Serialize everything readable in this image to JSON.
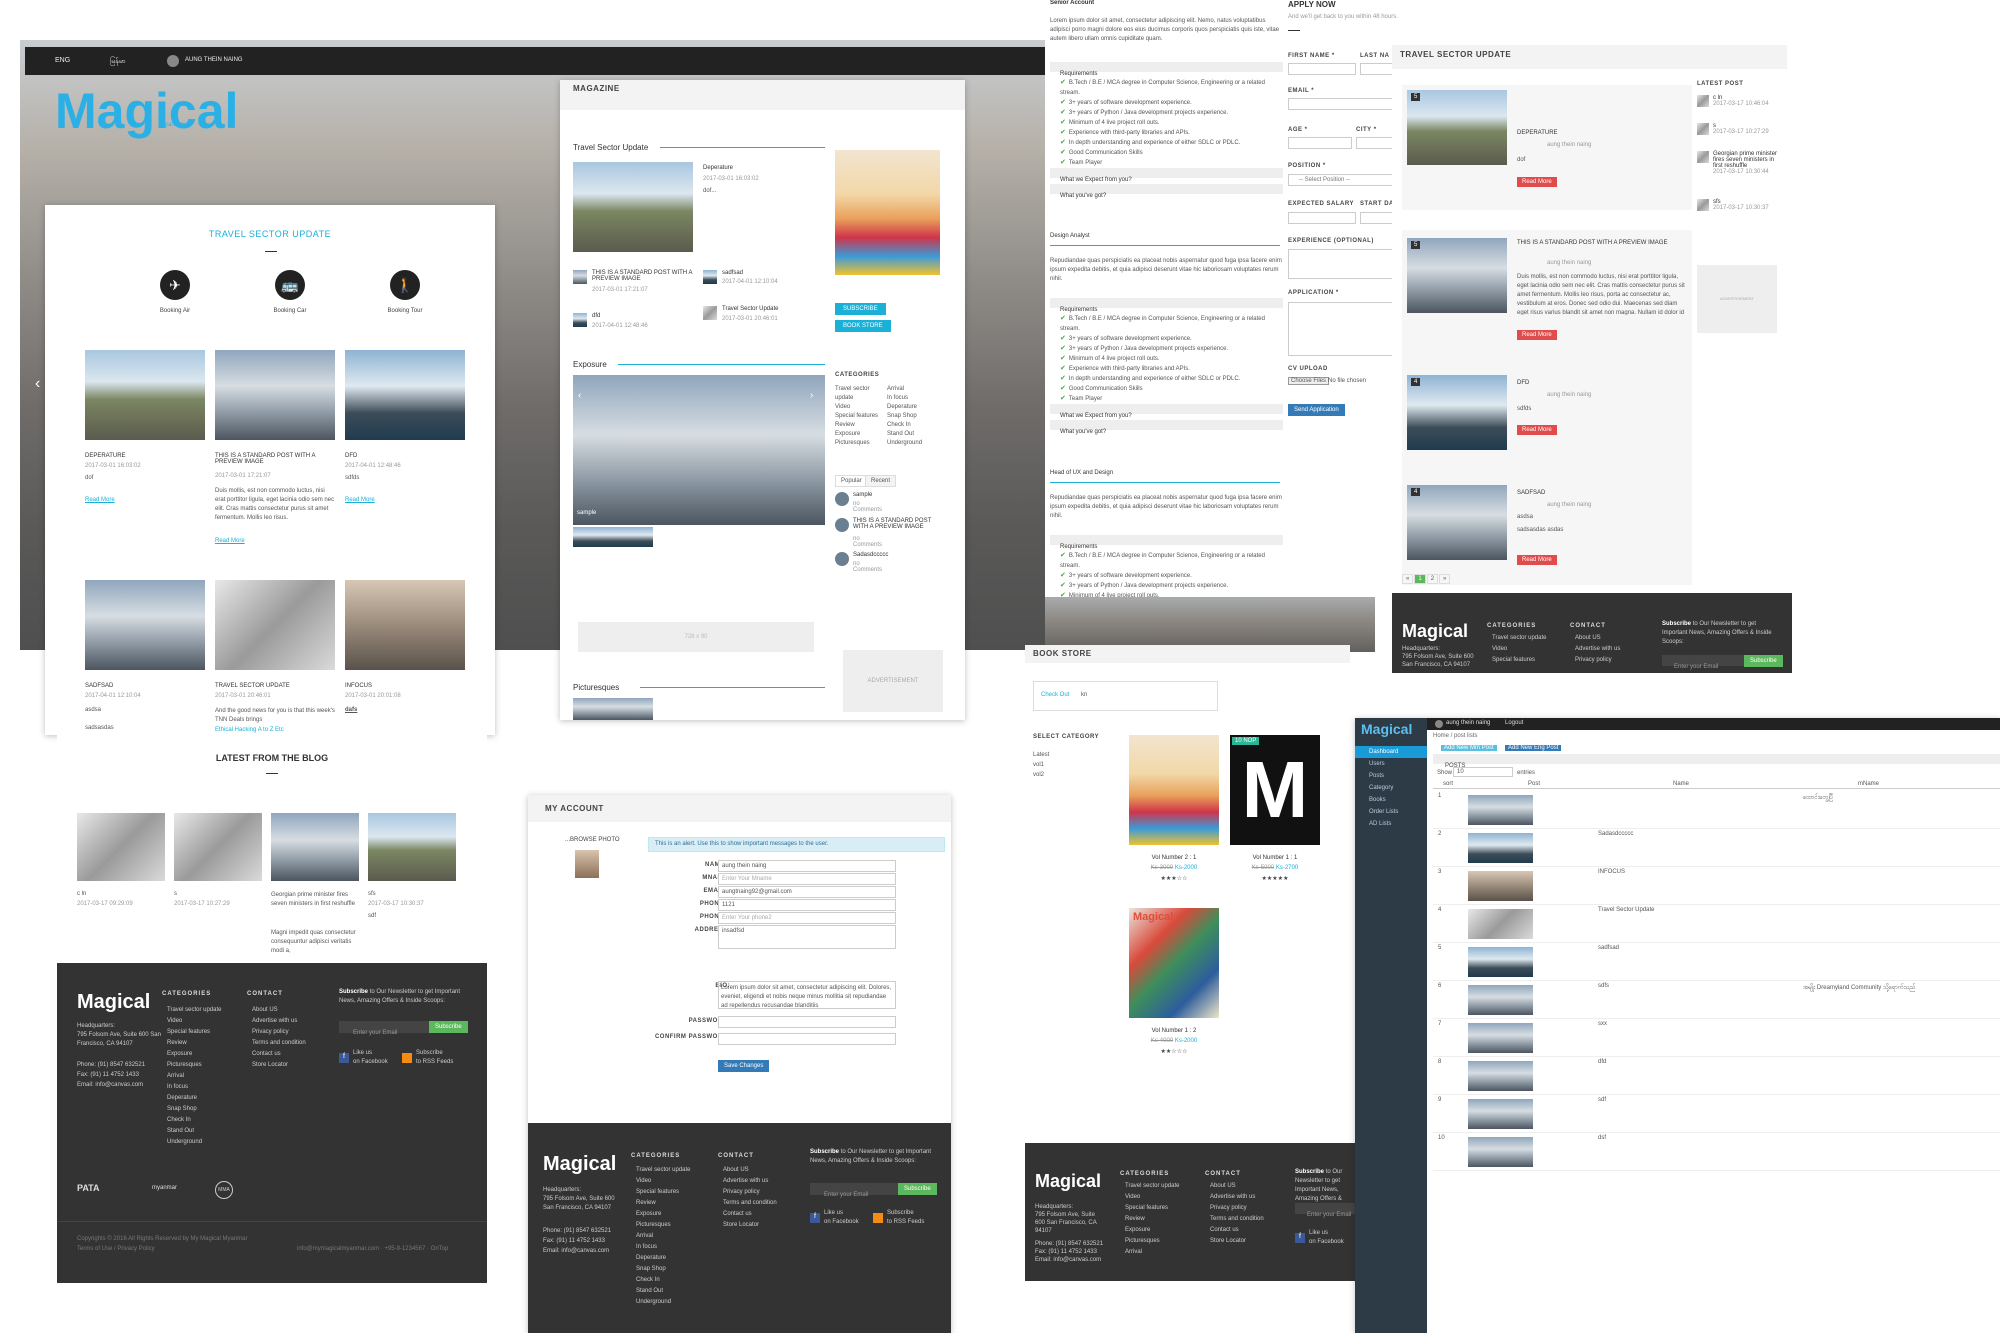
{
  "topbar": {
    "lang_en": "ENG",
    "lang_mm": "မြန်မာ",
    "user": "AUNG THEIN NAING"
  },
  "brand": {
    "logo": "Magical",
    "logo_sub": "myanmar",
    "my": "my"
  },
  "home": {
    "section_title": "TRAVEL SECTOR UPDATE",
    "booking": [
      "Booking Air",
      "Booking Car",
      "Booking Tour"
    ],
    "posts": [
      {
        "title": "DEPERATURE",
        "meta": "2017-03-01 16:03:02",
        "excerpt": "dof",
        "more": "Read More"
      },
      {
        "title": "THIS IS A STANDARD POST WITH A PREVIEW IMAGE",
        "meta": "2017-03-01 17:21:07",
        "excerpt": "Duis mollis, est non commodo luctus, nisi erat porttitor ligula, eget lacinia odio sem nec elit. Cras mattis consectetur purus sit amet fermentum. Mollis leo risus.",
        "more": "Read More"
      },
      {
        "title": "DFD",
        "meta": "2017-04-01 12:48:46",
        "excerpt": "sdfds",
        "more": "Read More"
      },
      {
        "title": "SADFSAD",
        "meta": "2017-04-01 12:10:04",
        "excerpt": "asdsa",
        "extra": "sadsasdas"
      },
      {
        "title": "TRAVEL SECTOR UPDATE",
        "meta": "2017-03-01 20:46:01",
        "excerpt": "And the good news for you is that this week's TNN Deals brings",
        "link": "Ethical Hacking A to Z Etc"
      },
      {
        "title": "INFOCUS",
        "meta": "2017-03-01 20:01:08",
        "excerpt": "dafs"
      }
    ],
    "blog_title": "LATEST FROM THE BLOG",
    "blog": [
      {
        "title": "c ln",
        "meta": "2017-03-17 09:29:09"
      },
      {
        "title": "s",
        "meta": "2017-03-17 10:27:29"
      },
      {
        "title": "Georgian prime minister fires seven ministers in first reshuffle",
        "excerpt": "Magni impedit quas consectetur consequuntur adipisci veritatis modi a,"
      },
      {
        "title": "sfs",
        "meta": "2017-03-17 10:30:37",
        "excerpt": "sdf"
      }
    ],
    "copyright": "Copyrights © 2016 All Rights Reserved by My Magical Myanmar",
    "terms": "Terms of Use / Privacy Policy",
    "contact_line": "info@mymagicalmyanmar.com · +95-9-1234567 · OnTop"
  },
  "footer": {
    "categories_title": "CATEGORIES",
    "categories": [
      "Travel sector update",
      "Video",
      "Special features",
      "Review",
      "Exposure",
      "Picturesques",
      "Arrival",
      "In focus",
      "Deperature",
      "Snap Shop",
      "Check In",
      "Stand Out",
      "Underground"
    ],
    "contact_title": "CONTACT",
    "contact": [
      "About US",
      "Advertise with us",
      "Privacy policy",
      "Terms and condition",
      "Contact us",
      "Store Locator"
    ],
    "hq_label": "Headquarters:",
    "hq": "795 Folsom Ave, Suite 600 San Francisco, CA 94107",
    "phone": "Phone: (91) 8547 632521",
    "fax": "Fax: (91) 11 4752 1433",
    "email": "Email: info@canvas.com",
    "subscribe_lead": "Subscribe",
    "subscribe_text": "to Our Newsletter to get Important News, Amazing Offers & Inside Scoops:",
    "email_placeholder": "Enter your Email",
    "subscribe_btn": "Subscribe",
    "like": "Like us",
    "on_facebook": "on Facebook",
    "subscribe2": "Subscribe",
    "rss": "to RSS Feeds",
    "partners": [
      "PATA",
      "myanmar",
      "MMA"
    ]
  },
  "magazine": {
    "title": "MAGAZINE",
    "sec1": "Travel Sector Update",
    "feature": {
      "title": "Deperature",
      "meta": "2017-03-01 16:03:02",
      "excerpt": "dof..."
    },
    "small": [
      {
        "title": "THIS IS A STANDARD POST WITH A PREVIEW IMAGE",
        "meta": "2017-03-01 17:21:07"
      },
      {
        "title": "sadfsad",
        "meta": "2017-04-01 12:10:04"
      },
      {
        "title": "dfd",
        "meta": "2017-04-01 12:48:46"
      },
      {
        "title": "Travel Sector Update",
        "meta": "2017-03-01 20:46:01"
      }
    ],
    "subscribe": "SUBSCRIBE",
    "bookstore": "BOOK STORE",
    "sec2": "Exposure",
    "img_caption": "sample",
    "categories_title": "CATEGORIES",
    "categories_a": [
      "Travel sector update",
      "Video",
      "Special features",
      "Review",
      "Exposure",
      "Picturesques"
    ],
    "categories_b": [
      "Arrival",
      "In focus",
      "Deperature",
      "Snap Shop",
      "Check In",
      "Stand Out",
      "Underground"
    ],
    "tabs": [
      "Popular",
      "Recent"
    ],
    "popular": [
      {
        "title": "sample",
        "meta": "no Comments"
      },
      {
        "title": "THIS IS A STANDARD POST WITH A PREVIEW IMAGE",
        "meta": "no Comments"
      },
      {
        "title": "Sadasdccccc",
        "meta": "no Comments"
      }
    ],
    "ad1": "728 x 90",
    "ad2": "ADVERTISEMENT",
    "sec3": "Picturesques"
  },
  "account": {
    "title": "MY ACCOUNT",
    "browse": "...BROWSE PHOTO",
    "alert": "This is an alert. Use this to show important messages to the user.",
    "fields": [
      {
        "label": "NAME:*",
        "value": "aung thein naing",
        "placeholder": ""
      },
      {
        "label": "MNAME:",
        "value": "",
        "placeholder": "Enter Your Mname"
      },
      {
        "label": "EMAIL:*",
        "value": "aungtnaing92@gmail.com",
        "placeholder": ""
      },
      {
        "label": "PHONE1:",
        "value": "1121",
        "placeholder": ""
      },
      {
        "label": "PHONE2:",
        "value": "",
        "placeholder": "Enter Your phone2"
      },
      {
        "label": "ADDRESS:",
        "value": "insadfsd",
        "placeholder": ""
      }
    ],
    "bio_label": "BIO:",
    "bio": "Lorem ipsum dolor sit amet, consectetur adipiscing elit. Dolores, eveniet, eligendi et nobis neque minus mollitia sit repudiandae ad repellendus recusandae blanditiis",
    "password_label": "PASSWORD:",
    "confirm_label": "CONFIRM PASSWORD:",
    "save": "Save Changes"
  },
  "jobs": {
    "senior": "Senior Account",
    "intro": "Lorem ipsum dolor sit amet, consectetur adipiscing elit. Nemo, natus voluptatibus adipisci porro magni dolore eos eius ducimus corporis quos perspiciatis quis iste, vitae autem libero ullam omnis cupiditate quam.",
    "requirements": "Requirements",
    "reqs": [
      "B.Tech / B.E / MCA degree in Computer Science, Engineering or a related stream.",
      "3+ years of software development experience.",
      "3+ years of Python / Java development projects experience.",
      "Minimum of 4 live project roll outs.",
      "Experience with third-party libraries and APIs.",
      "In depth understanding and experience of either SDLC or PDLC.",
      "Good Communication Skills",
      "Team Player"
    ],
    "expect": "What we Expect from you?",
    "got": "What you've got?",
    "designer": "Design Analyst",
    "designer_text": "Repudiandae quas perspiciatis ea placeat nobis aspernatur quod fuga ipsa facere enim ipsum expedita debitis, et quia adipisci deserunt vitae hic laboriosam voluptates rerum nihil.",
    "head": "Head of UX and Design",
    "apply_title": "APPLY NOW",
    "apply_sub": "And we'll get back to you within 48 hours.",
    "first_name": "FIRST NAME *",
    "last_name": "LAST NA",
    "email": "EMAIL *",
    "age": "AGE *",
    "city": "CITY *",
    "position": "POSITION *",
    "position_ph": "-- Select Position --",
    "salary": "EXPECTED SALARY",
    "start": "START DA",
    "experience": "EXPERIENCE (OPTIONAL)",
    "application": "APPLICATION *",
    "cv": "CV UPLOAD",
    "choose": "Choose Files",
    "no_file": "No file chosen",
    "send": "Send Application"
  },
  "travel": {
    "title": "TRAVEL SECTOR UPDATE",
    "latest": "LATEST POST",
    "posts": [
      {
        "day": "5",
        "title": "DEPERATURE",
        "author": "aung thein naing",
        "excerpt": "dof",
        "more": "Read More"
      },
      {
        "day": "5",
        "title": "THIS IS A STANDARD POST WITH A PREVIEW IMAGE",
        "author": "aung thein naing",
        "excerpt": "Duis mollis, est non commodo luctus, nisi erat porttitor ligula, eget lacinia odio sem nec elit. Cras mattis consectetur purus sit amet fermentum. Mollis leo risus, porta ac consectetur ac, vestibulum at eros. Donec sed odio dui. Maecenas sed diam eget risus varius blandit sit amet non magna. Nullam id dolor id nibh ultricies vehicula ut id elit. Cras mattis consectetur purus sit amet fermentum. Aenean lacinia bibendum nulla sed consectetur. Nullam id dolor id",
        "more": "Read More"
      },
      {
        "day": "4",
        "title": "DFD",
        "author": "aung thein naing",
        "excerpt": "sdfds",
        "more": "Read More"
      },
      {
        "day": "4",
        "title": "SADFSAD",
        "author": "aung thein naing",
        "excerpt": "asdsa",
        "extra": "sadsasdas asdas",
        "more": "Read More"
      }
    ],
    "latest_posts": [
      {
        "title": "c ln",
        "meta": "2017-03-17 10:46:04"
      },
      {
        "title": "s",
        "meta": "2017-03-17 10:27:29"
      },
      {
        "title": "Georgian prime minister fires seven ministers in first reshuffle",
        "meta": "2017-03-17 10:30:44"
      },
      {
        "title": "sfs",
        "meta": "2017-03-17 10:30:37"
      }
    ],
    "ad": "ADVERTISEMENT",
    "pages": [
      "«",
      "1",
      "2",
      "»"
    ]
  },
  "bookstore": {
    "title": "BOOK STORE",
    "checkout": "Check Out",
    "checkout_count": "kn",
    "select_category": "SELECT CATEGORY",
    "cats": [
      "Latest",
      "vol1",
      "vol2"
    ],
    "books": [
      {
        "name": "Vol Number 2 : 1",
        "old": "Ks-3000",
        "price": "Ks-2000",
        "stars": "★★★☆☆"
      },
      {
        "name": "Vol Number 1 : 1",
        "old": "Ks-5000",
        "price": "Ks-2700",
        "stars": "★★★★★",
        "badge": "10 NOP"
      },
      {
        "name": "Vol Number 1 : 2",
        "old": "Ks-4000",
        "price": "Ks-2000",
        "stars": "★★☆☆☆"
      }
    ]
  },
  "admin": {
    "logo": "Magical",
    "user": "aung thein naing",
    "logout": "Logout",
    "nav": [
      "Dashboard",
      "Users",
      "Posts",
      "Category",
      "Books",
      "Order Lists",
      "AD Lists"
    ],
    "breadcrumb_home": "Home",
    "breadcrumb_page": "post lists",
    "add_mm": "Add New Mm Post",
    "add_eng": "Add New Eng Post",
    "panel_title": "POSTS",
    "show": "Show",
    "entries_value": "10",
    "entries": "entries",
    "cols": [
      "sort",
      "Post",
      "Name",
      "mName"
    ],
    "rows": [
      {
        "n": "1",
        "name": "",
        "mname": "ထောင်းတွေ့ပြီ"
      },
      {
        "n": "2",
        "name": "Sadasdccccc",
        "mname": ""
      },
      {
        "n": "3",
        "name": "INFOCUS",
        "mname": ""
      },
      {
        "n": "4",
        "name": "Travel Sector Update",
        "mname": ""
      },
      {
        "n": "5",
        "name": "sadfsad",
        "mname": ""
      },
      {
        "n": "6",
        "name": "sdfs",
        "mname": "အမျိုး Dreamyland Community သို့ရောက်သည်"
      },
      {
        "n": "7",
        "name": "sxx",
        "mname": ""
      },
      {
        "n": "8",
        "name": "dfd",
        "mname": ""
      },
      {
        "n": "9",
        "name": "sdf",
        "mname": ""
      },
      {
        "n": "10",
        "name": "dsf",
        "mname": ""
      }
    ]
  }
}
